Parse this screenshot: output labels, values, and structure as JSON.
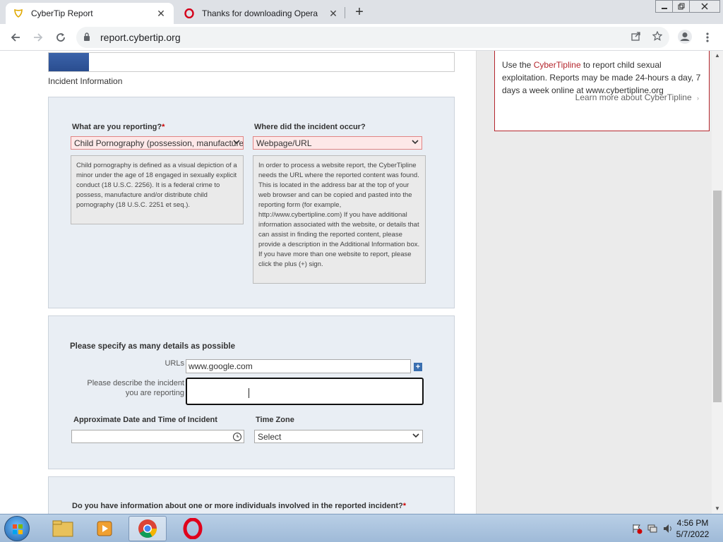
{
  "browser": {
    "tabs": [
      {
        "title": "CyberTip Report",
        "icon": "cybertip-favicon"
      },
      {
        "title": "Thanks for downloading Opera",
        "icon": "opera-favicon"
      }
    ],
    "url": "report.cybertip.org",
    "close_glyph": "✕",
    "new_tab_glyph": "+"
  },
  "sidebar": {
    "text_before": "Use the ",
    "brand": "CyberTipline",
    "text_after": " to report child sexual exploitation. Reports may be made 24-hours a day, 7 days a week online at www.cybertipline.org",
    "learn_more": "Learn more about CyberTipline"
  },
  "progress": {
    "fraction": 0.1
  },
  "section_title": "Incident Information",
  "incident": {
    "reporting_label": "What are you reporting?",
    "required_mark": "*",
    "reporting_value": "Child Pornography (possession, manufacture",
    "location_label": "Where did the incident occur?",
    "location_value": "Webpage/URL",
    "reporting_help": "Child pornography is defined as a visual depiction of a minor under the age of 18 engaged in sexually explicit conduct (18 U.S.C. 2256). It is a federal crime to possess, manufacture and/or distribute child pornography (18 U.S.C. 2251 et seq.).",
    "location_help": "In order to process a website report, the CyberTipline needs the URL where the reported content was found. This is located in the address bar at the top of your web browser and can be copied and pasted into the reporting form (for example, http://www.cybertipline.com) If you have additional information associated with the website, or details that can assist in finding the reported content, please provide a description in the Additional Information box. If you have more than one website to report, please click the plus (+) sign."
  },
  "details": {
    "title": "Please specify as many details as possible",
    "urls_label": "URLs",
    "urls_value": "www.google.com",
    "describe_label_1": "Please describe the incident",
    "describe_label_2": "you are reporting",
    "date_label": "Approximate Date and Time of Incident",
    "timezone_label": "Time Zone",
    "timezone_value": "Select"
  },
  "individuals": {
    "question": "Do you have information about one or more individuals involved in the reported incident?",
    "required_mark": "*"
  },
  "taskbar": {
    "time": "4:56 PM",
    "date": "5/7/2022"
  }
}
